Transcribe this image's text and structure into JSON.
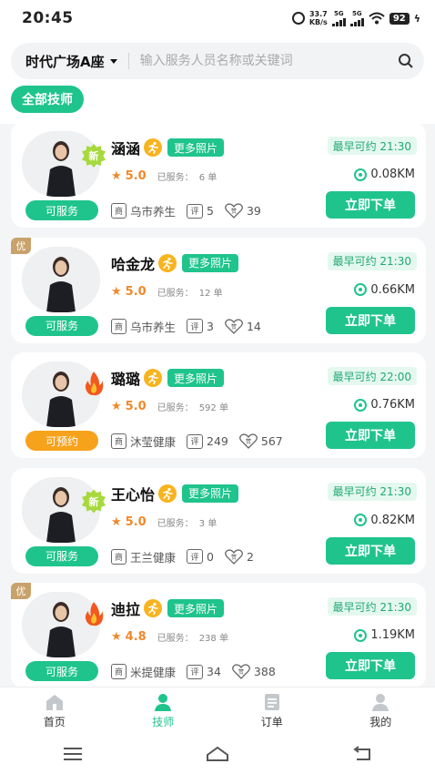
{
  "status_bar": {
    "time": "20:45",
    "net_speed": "33.7",
    "net_speed_unit": "KB/s",
    "sig1": "5G",
    "sig2": "5G",
    "battery": "92"
  },
  "header": {
    "location": "时代广场A座",
    "search_placeholder": "输入服务人员名称或关键词",
    "filter_all": "全部技师"
  },
  "labels": {
    "more_photos": "更多照片",
    "served": "已服务：",
    "order": "立即下单",
    "shop_icon": "商",
    "review_icon": "评",
    "like_icon": "赞",
    "you_tag": "优",
    "new_badge": "新"
  },
  "technicians": [
    {
      "name": "涵涵",
      "status": "可服务",
      "status_color": "#1fc48d",
      "rating": "5.0",
      "served": "6 单",
      "earliest": "最早可约 21:30",
      "distance": "0.08KM",
      "shop": "乌市养生",
      "reviews": "5",
      "likes": "39",
      "badge": "new",
      "you": false
    },
    {
      "name": "哈金龙",
      "status": "可服务",
      "status_color": "#1fc48d",
      "rating": "5.0",
      "served": "12 单",
      "earliest": "最早可约 21:30",
      "distance": "0.66KM",
      "shop": "乌市养生",
      "reviews": "3",
      "likes": "14",
      "badge": "none",
      "you": true
    },
    {
      "name": "璐璐",
      "status": "可预约",
      "status_color": "#f7a21b",
      "rating": "5.0",
      "served": "592 单",
      "earliest": "最早可约 22:00",
      "distance": "0.76KM",
      "shop": "沐莹健康",
      "reviews": "249",
      "likes": "567",
      "badge": "fire",
      "you": false
    },
    {
      "name": "王心怡",
      "status": "可服务",
      "status_color": "#1fc48d",
      "rating": "5.0",
      "served": "3 单",
      "earliest": "最早可约 21:30",
      "distance": "0.82KM",
      "shop": "王兰健康",
      "reviews": "0",
      "likes": "2",
      "badge": "new",
      "you": false
    },
    {
      "name": "迪拉",
      "status": "可服务",
      "status_color": "#1fc48d",
      "rating": "4.8",
      "served": "238 单",
      "earliest": "最早可约 21:30",
      "distance": "1.19KM",
      "shop": "米提健康",
      "reviews": "34",
      "likes": "388",
      "badge": "fire",
      "you": true
    }
  ],
  "tabbar": {
    "home": "首页",
    "technician": "技师",
    "orders": "订单",
    "mine": "我的",
    "active_color": "#1fc48d"
  }
}
